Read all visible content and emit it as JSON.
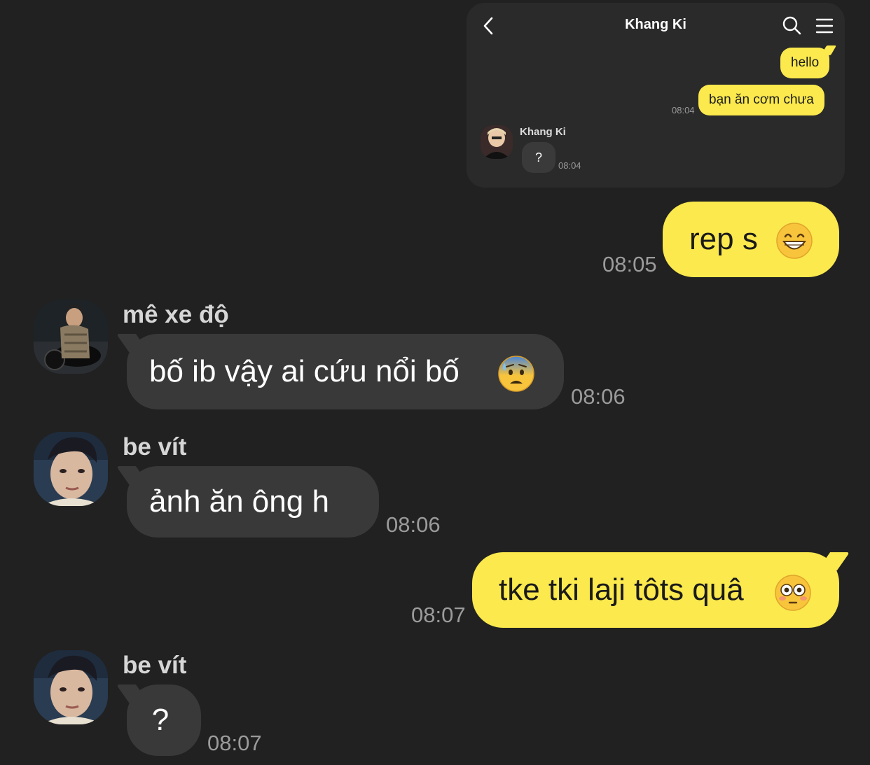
{
  "embedded_screenshot": {
    "title": "Khang Ki",
    "icons": {
      "back": "chevron-left-icon",
      "search": "search-icon",
      "menu": "menu-icon"
    },
    "messages": [
      {
        "direction": "out",
        "text": "hello"
      },
      {
        "direction": "out",
        "text": "bạn ăn cơm chưa",
        "time": "08:04"
      },
      {
        "direction": "in",
        "sender": "Khang Ki",
        "text": "?",
        "time": "08:04"
      }
    ]
  },
  "chat": {
    "messages": [
      {
        "direction": "out",
        "text": "rep s",
        "emoji": "grinning-face-emoji",
        "time": "08:05"
      },
      {
        "direction": "in",
        "sender": "mê xe độ",
        "text": "bố ib vậy ai cứu nổi bố",
        "emoji": "anxious-sweat-face-emoji",
        "time": "08:06"
      },
      {
        "direction": "in",
        "sender": "be vít",
        "text": "ảnh ăn ông h",
        "time": "08:06"
      },
      {
        "direction": "out",
        "text": "tke tki laji tôts quâ",
        "emoji": "flushed-face-emoji",
        "time": "08:07"
      },
      {
        "direction": "in",
        "sender": "be vít",
        "text": "?",
        "time": "08:07"
      }
    ]
  },
  "colors": {
    "background": "#212121",
    "outgoing_bubble": "#fbe94d",
    "incoming_bubble": "#393939",
    "timestamp": "#9b9b9b"
  }
}
